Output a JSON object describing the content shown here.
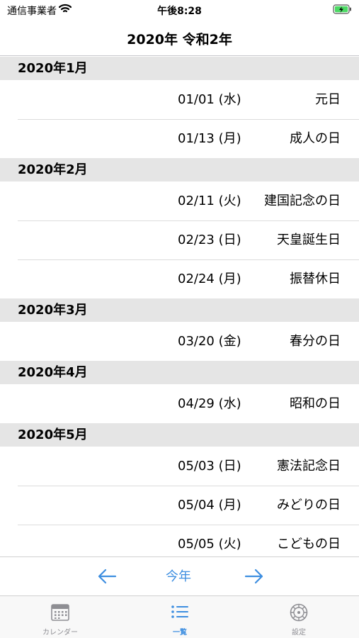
{
  "status_bar": {
    "carrier": "通信事業者",
    "time": "午後8:28"
  },
  "nav": {
    "title": "2020年 令和2年"
  },
  "sections": [
    {
      "header": "2020年1月",
      "rows": [
        {
          "date": "01/01 (水)",
          "name": "元日"
        },
        {
          "date": "01/13 (月)",
          "name": "成人の日"
        }
      ]
    },
    {
      "header": "2020年2月",
      "rows": [
        {
          "date": "02/11 (火)",
          "name": "建国記念の日"
        },
        {
          "date": "02/23 (日)",
          "name": "天皇誕生日"
        },
        {
          "date": "02/24 (月)",
          "name": "振替休日"
        }
      ]
    },
    {
      "header": "2020年3月",
      "rows": [
        {
          "date": "03/20 (金)",
          "name": "春分の日"
        }
      ]
    },
    {
      "header": "2020年4月",
      "rows": [
        {
          "date": "04/29 (水)",
          "name": "昭和の日"
        }
      ]
    },
    {
      "header": "2020年5月",
      "rows": [
        {
          "date": "05/03 (日)",
          "name": "憲法記念日"
        },
        {
          "date": "05/04 (月)",
          "name": "みどりの日"
        },
        {
          "date": "05/05 (火)",
          "name": "こどもの日"
        }
      ]
    }
  ],
  "year_nav": {
    "this_year_label": "今年"
  },
  "tabs": [
    {
      "label": "カレンダー",
      "icon": "calendar-icon",
      "active": false
    },
    {
      "label": "一覧",
      "icon": "list-icon",
      "active": true
    },
    {
      "label": "設定",
      "icon": "settings-gear-icon",
      "active": false
    }
  ],
  "colors": {
    "accent": "#3d8ee0",
    "section_bg": "#e5e5e5",
    "inactive_tab": "#8e8e93"
  }
}
